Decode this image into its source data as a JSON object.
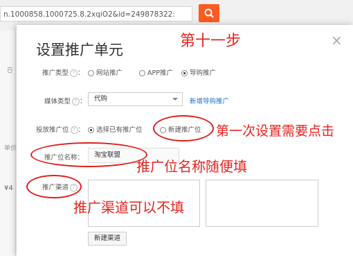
{
  "background": {
    "url_text": "n.1000858.1000725.8.2xqiO2&id=249878322:",
    "left_marks": [
      "ID",
      "单价",
      "¥4"
    ]
  },
  "dialog": {
    "title": "设置推广单元",
    "close": "×",
    "promo_type": {
      "label": "推广类型",
      "options": [
        {
          "label": "网站推广",
          "selected": false
        },
        {
          "label": "APP推广",
          "selected": false
        },
        {
          "label": "导购推广",
          "selected": true
        }
      ]
    },
    "media_type": {
      "label": "媒体类型",
      "value": "代购",
      "add_link": "新增导购推广"
    },
    "slot": {
      "label": "投放推广位",
      "options": [
        {
          "label": "选择已有推广位",
          "selected": true
        },
        {
          "label": "新建推广位",
          "selected": false
        }
      ]
    },
    "slot_name": {
      "label": "推广位名称：",
      "value": "淘宝联盟"
    },
    "channel": {
      "label": "推广渠道",
      "new_button": "新建渠道"
    }
  },
  "annotations": {
    "step": "第十一步",
    "first_time": "第一次设置需要点击",
    "name_any": "推广位名称随便填",
    "channel_optional": "推广渠道可以不填"
  },
  "colors": {
    "annotation": "#e8231d",
    "search_button": "#ff5a1f",
    "link": "#1c6fd6"
  }
}
